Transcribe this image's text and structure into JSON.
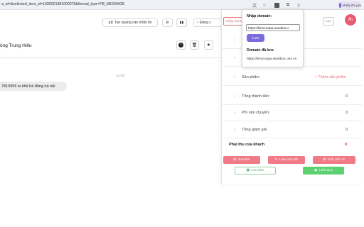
{
  "browser": {
    "url": "a_id=&selected_item_id=1000021381000078&thread_type=FB_MESSAGE",
    "profile_label": "Verify it's you"
  },
  "toolbar": {
    "ads_button_label": "Tạo quảng cáo nhắn tin",
    "partial_button_label": "Đang c"
  },
  "conversation": {
    "name": "ông Trung Hiếu",
    "time": "11:08",
    "message": "7810955  la khê hà đông hà nội"
  },
  "panel": {
    "tab_left": "Nhập domai",
    "tab_right": "Lọc",
    "avatar_initials": "Ấn",
    "rows": [
      {
        "label": "Sản phẩm",
        "add_label": "+ Thêm sản phẩm"
      },
      {
        "label": "Tổng thành tiền:",
        "value": "0"
      },
      {
        "label": "Phí vận chuyển:",
        "value": "0"
      },
      {
        "label": "Tổng giảm giá:",
        "value": "0"
      }
    ],
    "pay_label": "Phải thu của khách",
    "pay_value": "0",
    "voucher_label": "Voucher",
    "refresh_label": "Làm mới SP",
    "shipping_fee_label": "Tính phí VC",
    "save_order_label": "Lưu đơn",
    "close_order_label": "Chốt đơn",
    "colors": {
      "accent": "#e86c78",
      "green": "#4cc96a"
    }
  },
  "popup": {
    "domain_label": "Nhập domain:",
    "domain_input_value": "https://kimcucspa.sandbox.c",
    "save_label": "Lưu",
    "saved_label": "Domain đã lưu:",
    "saved_value": "https://kimcucspa.sandbox.com.vn"
  }
}
